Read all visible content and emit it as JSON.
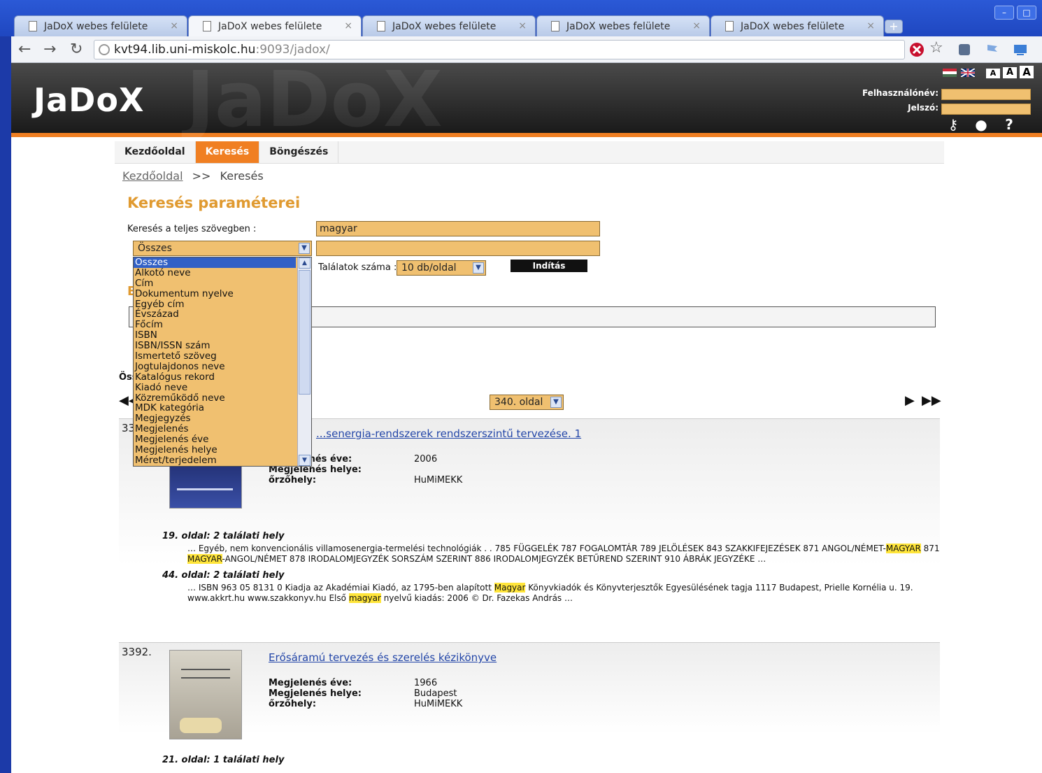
{
  "browser": {
    "tabs": [
      {
        "label": "JaDoX webes felülete"
      },
      {
        "label": "JaDoX webes felülete"
      },
      {
        "label": "JaDoX webes felülete"
      },
      {
        "label": "JaDoX webes felülete"
      },
      {
        "label": "JaDoX webes felülete"
      }
    ],
    "url_host": "kvt94.lib.uni-miskolc.hu",
    "url_path": ":9093/jadox/"
  },
  "header": {
    "logo": "JaDoX",
    "font_sizes": [
      "A",
      "A",
      "A"
    ],
    "username_label": "Felhasználónév:",
    "password_label": "Jelszó:"
  },
  "menu": {
    "items": [
      {
        "label": "Kezdőoldal"
      },
      {
        "label": "Keresés"
      },
      {
        "label": "Böngészés"
      }
    ],
    "active_color": "#f07f22"
  },
  "breadcrumb": {
    "home": "Kezdőoldal",
    "sep": ">>",
    "current": "Keresés"
  },
  "search": {
    "title": "Keresés paraméterei",
    "fulltext_label": "Keresés a teljes szövegben :",
    "fulltext_value": "magyar",
    "field_select": "Összes",
    "field_value": "",
    "hits_label": "Találatok száma :",
    "hits_select": "10 db/oldal",
    "start_button": "Indítás",
    "field_options": [
      "Összes",
      "Alkotó neve",
      "Cím",
      "Dokumentum nyelve",
      "Egyéb cím",
      "Évszázad",
      "Főcím",
      "ISBN",
      "ISBN/ISSN szám",
      "Ismertető szöveg",
      "Jogtulajdonos neve",
      "Katalógus rekord",
      "Kiadó neve",
      "Közreműködő neve",
      "MDK kategória",
      "Megjegyzés",
      "Megjelenés",
      "Megjelenés éve",
      "Megjelenés helye",
      "Méret/terjedelem"
    ]
  },
  "ghost": {
    "letter": "E",
    "oss": "Öss"
  },
  "pager": {
    "page_select": "340. oldal"
  },
  "results": [
    {
      "num": "339",
      "title": "...senergia-rendszerek rendszerszintű tervezése. 1",
      "meta": [
        {
          "k": "Megjelenés éve:",
          "v": "2006"
        },
        {
          "k": "Megjelenés helye:",
          "v": ""
        },
        {
          "k": "őrzőhely:",
          "v": "HuMiMEKK"
        }
      ],
      "hits": [
        {
          "head": "19. oldal: 2 találati hely",
          "parts": [
            {
              "t": "… Egyéb, nem konvencionális villamosenergia-termelési technológiák . . 785 FÜGGELÉK 787 FOGALOMTÁR 789 JELÖLÉSEK 843 SZAKKIFEJEZÉSEK 871 ANGOL/NÉMET-",
              "h": false
            },
            {
              "t": "MAGYAR",
              "h": true
            },
            {
              "t": " 871 ",
              "h": false
            },
            {
              "t": "MAGYAR",
              "h": true
            },
            {
              "t": "-ANGOL/NÉMET 878 IRODALOMJEGYZÉK SORSZÁM SZERINT 886 IRODALOMJEGYZÉK BETŰREND SZERINT 910 ÁBRÁK JEGYZÉKE …",
              "h": false
            }
          ]
        },
        {
          "head": "44. oldal: 2 találati hely",
          "parts": [
            {
              "t": "… ISBN 963 05 8131 0 Kiadja az Akadémiai Kiadó, az 1795-ben alapított ",
              "h": false
            },
            {
              "t": "Magyar",
              "h": true
            },
            {
              "t": " Könyvkiadók és Könyvterjesztők Egyesülésének tagja 1117 Budapest, Prielle Kornélia u. 19. www.akkrt.hu www.szakkonyv.hu Első ",
              "h": false
            },
            {
              "t": "magyar",
              "h": true
            },
            {
              "t": " nyelvű kiadás: 2006 © Dr. Fazekas András …",
              "h": false
            }
          ]
        }
      ]
    },
    {
      "num": "3392.",
      "title": "Erősáramú tervezés és szerelés kézikönyve",
      "meta": [
        {
          "k": "Megjelenés éve:",
          "v": "1966"
        },
        {
          "k": "Megjelenés helye:",
          "v": "Budapest"
        },
        {
          "k": "őrzőhely:",
          "v": "HuMiMEKK"
        }
      ],
      "hits": [
        {
          "head": "21. oldal: 1 találati hely",
          "parts": []
        }
      ]
    }
  ]
}
